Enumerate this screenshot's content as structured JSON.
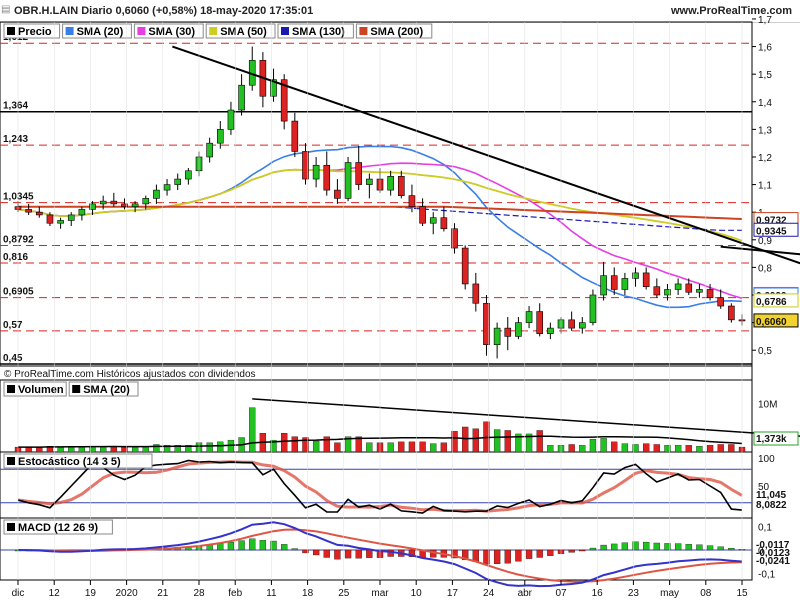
{
  "header": {
    "title": "OBR.H.LAIN Diario 0,6060 (+0,58%) 18-may-2020 17:35:01",
    "site": "www.ProRealTime.com",
    "menu_icon": "collapse-icon"
  },
  "chart_data": [
    {
      "type": "line",
      "name": "price-panel",
      "legend": [
        {
          "label": "Precio",
          "color": "#000000"
        },
        {
          "label": "SMA (20)",
          "color": "#3a7fe6"
        },
        {
          "label": "SMA (30)",
          "color": "#e43ee4"
        },
        {
          "label": "SMA (50)",
          "color": "#cccc22"
        },
        {
          "label": "SMA (130)",
          "color": "#1a1ab0"
        },
        {
          "label": "SMA (200)",
          "color": "#cc4422"
        }
      ],
      "x_ticks": [
        "dic",
        "12",
        "19",
        "2020",
        "21",
        "28",
        "feb",
        "11",
        "18",
        "25",
        "mar",
        "10",
        "17",
        "24",
        "abr",
        "07",
        "16",
        "23",
        "may",
        "08",
        "15"
      ],
      "y_ticks": [
        "1,7",
        "1,6",
        "1,5",
        "1,4",
        "1,3",
        "1,2",
        "1,1",
        "1",
        "0,9",
        "0,8",
        "0,7",
        "0,6",
        "0,5"
      ],
      "ylim": [
        0.45,
        1.66
      ],
      "levels": [
        {
          "label": "1,612",
          "value": 1.612,
          "style": "dashed"
        },
        {
          "label": "1,364",
          "value": 1.364,
          "style": "solid"
        },
        {
          "label": "1,243",
          "value": 1.243,
          "style": "dashed"
        },
        {
          "label": "1,0345",
          "value": 1.0345,
          "style": "dashed"
        },
        {
          "label": "0,8792",
          "value": 0.8792,
          "style": "dashed"
        },
        {
          "label": "0,816",
          "value": 0.816,
          "style": "dashed"
        },
        {
          "label": "0,6905",
          "value": 0.6905,
          "style": "dashed"
        },
        {
          "label": "0,57",
          "value": 0.57,
          "style": "dashed"
        },
        {
          "label": "0,45",
          "value": 0.45,
          "style": "solid"
        }
      ],
      "right_labels": [
        {
          "text": "0,9732",
          "value": 0.9732,
          "color": "#cc4422"
        },
        {
          "text": "0,9345",
          "value": 0.9345,
          "color": "#1a1ab0"
        },
        {
          "text": "0,7020",
          "value": 0.702,
          "color": "#e43ee4"
        },
        {
          "text": "0,6999",
          "value": 0.6999,
          "color": "#3a7fe6"
        },
        {
          "text": "0,6786",
          "value": 0.6786,
          "color": "#cccc22"
        },
        {
          "text": "0,6060",
          "value": 0.606,
          "color": "#000000"
        }
      ],
      "trendlines": [
        {
          "from": [
            14.5,
            1.6
          ],
          "to": [
            91.5,
            0.575
          ]
        },
        {
          "from": [
            66,
            0.875
          ],
          "to": [
            115,
            0.695
          ]
        },
        {
          "from": [
            95,
            0.82
          ],
          "to": [
            115,
            0.62
          ]
        }
      ],
      "candles": [
        {
          "o": 1.02,
          "h": 1.04,
          "l": 1.0,
          "c": 1.01
        },
        {
          "o": 1.01,
          "h": 1.03,
          "l": 0.99,
          "c": 1.0
        },
        {
          "o": 1.0,
          "h": 1.02,
          "l": 0.98,
          "c": 0.99
        },
        {
          "o": 0.99,
          "h": 1.0,
          "l": 0.95,
          "c": 0.96
        },
        {
          "o": 0.96,
          "h": 0.98,
          "l": 0.94,
          "c": 0.97
        },
        {
          "o": 0.97,
          "h": 1.0,
          "l": 0.95,
          "c": 0.99
        },
        {
          "o": 0.99,
          "h": 1.02,
          "l": 0.97,
          "c": 1.01
        },
        {
          "o": 1.01,
          "h": 1.04,
          "l": 0.99,
          "c": 1.03
        },
        {
          "o": 1.03,
          "h": 1.06,
          "l": 1.01,
          "c": 1.04
        },
        {
          "o": 1.04,
          "h": 1.07,
          "l": 1.02,
          "c": 1.03
        },
        {
          "o": 1.03,
          "h": 1.05,
          "l": 1.01,
          "c": 1.02
        },
        {
          "o": 1.02,
          "h": 1.04,
          "l": 1.0,
          "c": 1.03
        },
        {
          "o": 1.03,
          "h": 1.06,
          "l": 1.01,
          "c": 1.05
        },
        {
          "o": 1.05,
          "h": 1.1,
          "l": 1.03,
          "c": 1.08
        },
        {
          "o": 1.08,
          "h": 1.12,
          "l": 1.06,
          "c": 1.1
        },
        {
          "o": 1.1,
          "h": 1.14,
          "l": 1.08,
          "c": 1.12
        },
        {
          "o": 1.12,
          "h": 1.16,
          "l": 1.1,
          "c": 1.15
        },
        {
          "o": 1.15,
          "h": 1.22,
          "l": 1.13,
          "c": 1.2
        },
        {
          "o": 1.2,
          "h": 1.27,
          "l": 1.18,
          "c": 1.25
        },
        {
          "o": 1.25,
          "h": 1.33,
          "l": 1.23,
          "c": 1.3
        },
        {
          "o": 1.3,
          "h": 1.4,
          "l": 1.28,
          "c": 1.37
        },
        {
          "o": 1.37,
          "h": 1.5,
          "l": 1.35,
          "c": 1.46
        },
        {
          "o": 1.46,
          "h": 1.6,
          "l": 1.44,
          "c": 1.55
        },
        {
          "o": 1.55,
          "h": 1.58,
          "l": 1.38,
          "c": 1.42
        },
        {
          "o": 1.42,
          "h": 1.52,
          "l": 1.4,
          "c": 1.48
        },
        {
          "o": 1.48,
          "h": 1.5,
          "l": 1.3,
          "c": 1.33
        },
        {
          "o": 1.33,
          "h": 1.36,
          "l": 1.2,
          "c": 1.22
        },
        {
          "o": 1.22,
          "h": 1.25,
          "l": 1.1,
          "c": 1.12
        },
        {
          "o": 1.12,
          "h": 1.2,
          "l": 1.09,
          "c": 1.17
        },
        {
          "o": 1.17,
          "h": 1.22,
          "l": 1.06,
          "c": 1.08
        },
        {
          "o": 1.08,
          "h": 1.12,
          "l": 1.03,
          "c": 1.05
        },
        {
          "o": 1.05,
          "h": 1.2,
          "l": 1.04,
          "c": 1.18
        },
        {
          "o": 1.18,
          "h": 1.24,
          "l": 1.08,
          "c": 1.1
        },
        {
          "o": 1.1,
          "h": 1.14,
          "l": 1.05,
          "c": 1.12
        },
        {
          "o": 1.12,
          "h": 1.16,
          "l": 1.07,
          "c": 1.08
        },
        {
          "o": 1.08,
          "h": 1.15,
          "l": 1.06,
          "c": 1.13
        },
        {
          "o": 1.13,
          "h": 1.15,
          "l": 1.05,
          "c": 1.06
        },
        {
          "o": 1.06,
          "h": 1.1,
          "l": 1.0,
          "c": 1.02
        },
        {
          "o": 1.02,
          "h": 1.05,
          "l": 0.95,
          "c": 0.96
        },
        {
          "o": 0.96,
          "h": 1.0,
          "l": 0.92,
          "c": 0.98
        },
        {
          "o": 0.98,
          "h": 1.02,
          "l": 0.93,
          "c": 0.94
        },
        {
          "o": 0.94,
          "h": 0.96,
          "l": 0.85,
          "c": 0.87
        },
        {
          "o": 0.87,
          "h": 0.88,
          "l": 0.72,
          "c": 0.74
        },
        {
          "o": 0.74,
          "h": 0.78,
          "l": 0.64,
          "c": 0.67
        },
        {
          "o": 0.67,
          "h": 0.7,
          "l": 0.48,
          "c": 0.52
        },
        {
          "o": 0.52,
          "h": 0.6,
          "l": 0.47,
          "c": 0.58
        },
        {
          "o": 0.58,
          "h": 0.62,
          "l": 0.5,
          "c": 0.55
        },
        {
          "o": 0.55,
          "h": 0.62,
          "l": 0.54,
          "c": 0.6
        },
        {
          "o": 0.6,
          "h": 0.66,
          "l": 0.58,
          "c": 0.64
        },
        {
          "o": 0.64,
          "h": 0.67,
          "l": 0.55,
          "c": 0.56
        },
        {
          "o": 0.56,
          "h": 0.6,
          "l": 0.54,
          "c": 0.58
        },
        {
          "o": 0.58,
          "h": 0.62,
          "l": 0.56,
          "c": 0.61
        },
        {
          "o": 0.61,
          "h": 0.64,
          "l": 0.57,
          "c": 0.58
        },
        {
          "o": 0.58,
          "h": 0.62,
          "l": 0.56,
          "c": 0.6
        },
        {
          "o": 0.6,
          "h": 0.72,
          "l": 0.59,
          "c": 0.7
        },
        {
          "o": 0.7,
          "h": 0.82,
          "l": 0.68,
          "c": 0.77
        },
        {
          "o": 0.77,
          "h": 0.8,
          "l": 0.7,
          "c": 0.72
        },
        {
          "o": 0.72,
          "h": 0.78,
          "l": 0.7,
          "c": 0.76
        },
        {
          "o": 0.76,
          "h": 0.8,
          "l": 0.73,
          "c": 0.78
        },
        {
          "o": 0.78,
          "h": 0.8,
          "l": 0.72,
          "c": 0.73
        },
        {
          "o": 0.73,
          "h": 0.76,
          "l": 0.69,
          "c": 0.7
        },
        {
          "o": 0.7,
          "h": 0.74,
          "l": 0.68,
          "c": 0.72
        },
        {
          "o": 0.72,
          "h": 0.76,
          "l": 0.7,
          "c": 0.74
        },
        {
          "o": 0.74,
          "h": 0.76,
          "l": 0.7,
          "c": 0.71
        },
        {
          "o": 0.71,
          "h": 0.74,
          "l": 0.69,
          "c": 0.72
        },
        {
          "o": 0.72,
          "h": 0.74,
          "l": 0.68,
          "c": 0.69
        },
        {
          "o": 0.69,
          "h": 0.72,
          "l": 0.65,
          "c": 0.66
        },
        {
          "o": 0.66,
          "h": 0.67,
          "l": 0.6,
          "c": 0.61
        },
        {
          "o": 0.61,
          "h": 0.63,
          "l": 0.59,
          "c": 0.606
        }
      ]
    },
    {
      "type": "bar",
      "name": "volume-panel",
      "legend": [
        {
          "label": "Volumen",
          "color": "#000000"
        },
        {
          "label": "SMA (20)",
          "color": "#000000"
        }
      ],
      "y_ticks": [
        "10M"
      ],
      "right_labels": [
        {
          "text": "1,373k",
          "color": "#2aa02a"
        }
      ],
      "volume_scale_max": 12000000
    },
    {
      "type": "line",
      "name": "stochastic-panel",
      "legend": [
        {
          "label": "Estocástico (14 3 5)",
          "color": "#000000"
        }
      ],
      "y_ticks": [
        "100",
        "50"
      ],
      "ylim": [
        0,
        100
      ],
      "levels": [
        80,
        20
      ],
      "right_labels": [
        {
          "text": "11,045",
          "color": "#cc4422"
        },
        {
          "text": "8,0822",
          "color": "#000000"
        }
      ]
    },
    {
      "type": "bar",
      "name": "macd-panel",
      "legend": [
        {
          "label": "MACD (12 26 9)",
          "color": "#000000"
        }
      ],
      "y_ticks": [
        "0,1",
        "0",
        "-0,1"
      ],
      "ylim": [
        -0.12,
        0.12
      ],
      "right_labels": [
        {
          "text": "-0,0117",
          "color": "#2aa02a"
        },
        {
          "text": "-0,0123",
          "color": "#cc4422"
        },
        {
          "text": "-0,0241",
          "color": "#000000"
        }
      ]
    }
  ],
  "footer_note": "© ProRealTime.com Históricos ajustados con dividendos",
  "colors": {
    "up": "#22c022",
    "down": "#dd2222",
    "grid": "#999999"
  }
}
